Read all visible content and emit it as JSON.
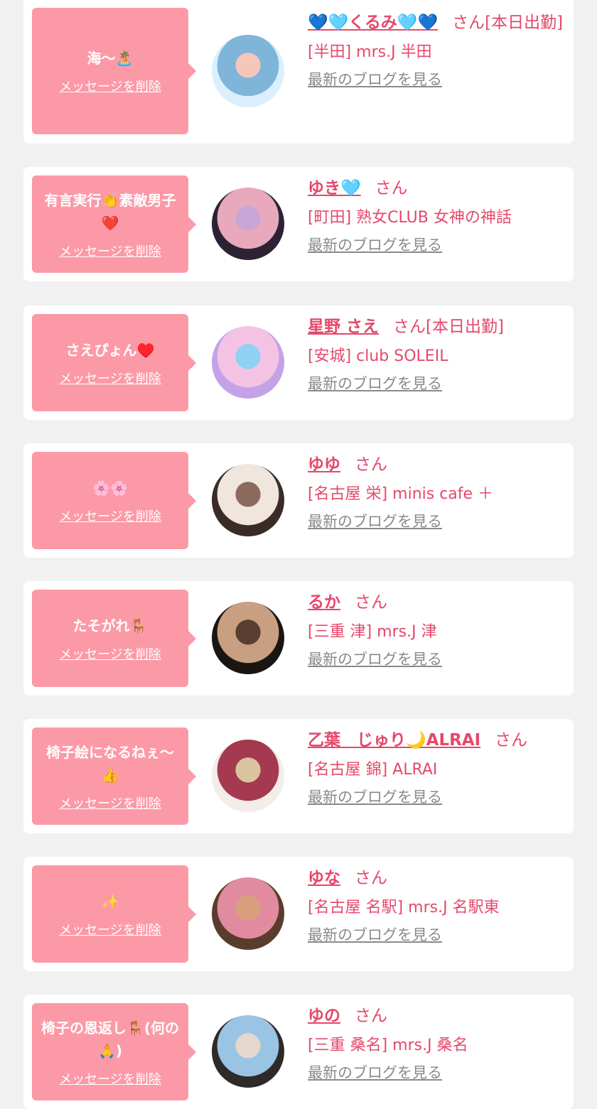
{
  "cards": [
    {
      "message": "海〜🏝️",
      "delete_label": "メッセージを削除",
      "name": "💙🩵くるみ🩵💙",
      "honorific": "さん[本日出勤]",
      "shop": "[半田] mrs.J 半田",
      "blog_label": "最新のブログを見る",
      "avatar_colors": [
        "#dbeffc",
        "#7eb5d8",
        "#f4c7b9"
      ]
    },
    {
      "message": "有言実行👏素敵男子❤️",
      "delete_label": "メッセージを削除",
      "name": "ゆき🩵",
      "honorific": "さん",
      "shop": "[町田] 熟女CLUB 女神の神話",
      "blog_label": "最新のブログを見る",
      "avatar_colors": [
        "#2c2233",
        "#e8a9bd",
        "#caa6d7"
      ]
    },
    {
      "message": "さえぴょん♥️",
      "delete_label": "メッセージを削除",
      "name": "星野 さえ",
      "honorific": "さん[本日出勤]",
      "shop": "[安城] club SOLEIL",
      "blog_label": "最新のブログを見る",
      "avatar_colors": [
        "#c4a2e8",
        "#f4c3e4",
        "#8fd1f2"
      ]
    },
    {
      "message": "🌸🌸",
      "delete_label": "メッセージを削除",
      "name": "ゆゆ",
      "honorific": "さん",
      "shop": "[名古屋 栄] minis cafe ＋",
      "blog_label": "最新のブログを見る",
      "avatar_colors": [
        "#3a2a28",
        "#f0e6de",
        "#8b6a5d"
      ]
    },
    {
      "message": "たそがれ🪑",
      "delete_label": "メッセージを削除",
      "name": "るか",
      "honorific": "さん",
      "shop": "[三重 津] mrs.J 津",
      "blog_label": "最新のブログを見る",
      "avatar_colors": [
        "#1a1512",
        "#c99f82",
        "#5a3e32"
      ]
    },
    {
      "message": "椅子絵になるねぇ〜👍",
      "delete_label": "メッセージを削除",
      "name": "乙葉　じゅり🌙ALRAI",
      "honorific": "さん",
      "shop": "[名古屋 錦] ALRAI",
      "blog_label": "最新のブログを見る",
      "avatar_colors": [
        "#f2ede8",
        "#a4394f",
        "#d9c4a0"
      ]
    },
    {
      "message": "✨",
      "delete_label": "メッセージを削除",
      "name": "ゆな",
      "honorific": "さん",
      "shop": "[名古屋 名駅] mrs.J 名駅東",
      "blog_label": "最新のブログを見る",
      "avatar_colors": [
        "#5a3c2e",
        "#e28aa0",
        "#d7a07a"
      ]
    },
    {
      "message": "椅子の恩返し🪑(何の🙏)",
      "delete_label": "メッセージを削除",
      "name": "ゆの",
      "honorific": "さん",
      "shop": "[三重 桑名] mrs.J 桑名",
      "blog_label": "最新のブログを見る",
      "avatar_colors": [
        "#2e2a29",
        "#9ac4e4",
        "#e6d8cc"
      ]
    }
  ]
}
